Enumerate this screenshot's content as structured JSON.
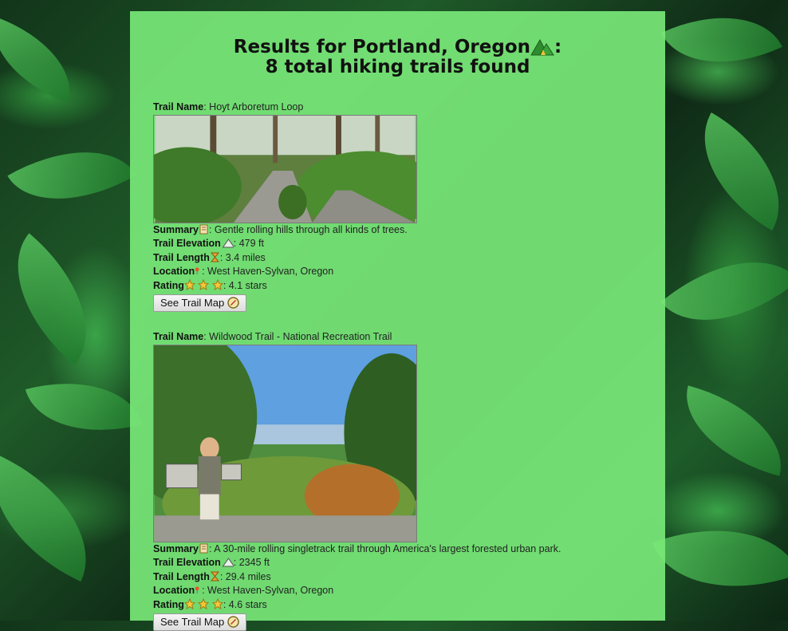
{
  "page": {
    "title_line1": "Results for Portland, Oregon",
    "title_line1_suffix": ":",
    "title_line2": "8 total hiking trails found"
  },
  "labels": {
    "trail_name": "Trail Name",
    "summary": "Summary",
    "elevation": "Trail Elevation",
    "length": "Trail Length",
    "location": "Location",
    "rating": "Rating",
    "see_map": "See Trail Map"
  },
  "trails": [
    {
      "name": ": Hoyt Arboretum Loop",
      "summary": ": Gentle rolling hills through all kinds of trees.",
      "elevation": ": 479 ft",
      "length": ": 3.4 miles",
      "location": ": West Haven-Sylvan, Oregon",
      "rating": ": 4.1 stars",
      "photo_desc": "forest path"
    },
    {
      "name": ": Wildwood Trail - National Recreation Trail",
      "summary": ": A 30-mile rolling singletrack trail through America's largest forested urban park.",
      "elevation": ": 2345 ft",
      "length": ": 29.4 miles",
      "location": ": West Haven-Sylvan, Oregon",
      "rating": ": 4.6 stars",
      "photo_desc": "viewpoint"
    }
  ],
  "icons": {
    "title": "mountain-icon",
    "summary": "scroll-icon",
    "elevation": "triangle-mountain-icon",
    "length": "hourglass-icon",
    "location": "map-pin-icon",
    "rating": "star-icon",
    "map_button": "compass-icon"
  },
  "colors": {
    "panel": "#78e878",
    "text": "#111111"
  }
}
